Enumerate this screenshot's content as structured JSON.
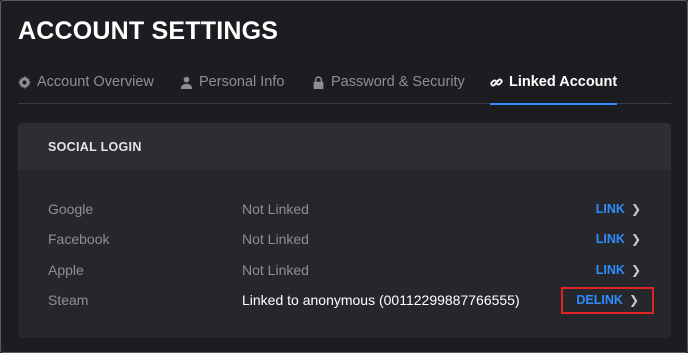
{
  "page": {
    "title": "ACCOUNT SETTINGS"
  },
  "tabs": [
    {
      "label": "Account Overview",
      "icon": "gear-icon"
    },
    {
      "label": "Personal Info",
      "icon": "user-icon"
    },
    {
      "label": "Password & Security",
      "icon": "lock-icon"
    },
    {
      "label": "Linked Account",
      "icon": "link-icon",
      "active": true
    }
  ],
  "social_login": {
    "header": "SOCIAL LOGIN",
    "rows": [
      {
        "provider": "Google",
        "status": "Not Linked",
        "action": "LINK"
      },
      {
        "provider": "Facebook",
        "status": "Not Linked",
        "action": "LINK"
      },
      {
        "provider": "Apple",
        "status": "Not Linked",
        "action": "LINK"
      },
      {
        "provider": "Steam",
        "status": "Linked to anonymous (00112299887766555)",
        "action": "DELINK"
      }
    ]
  },
  "colors": {
    "background": "#1c1d21",
    "accent": "#2f8cff",
    "highlight_border": "#e02424"
  }
}
